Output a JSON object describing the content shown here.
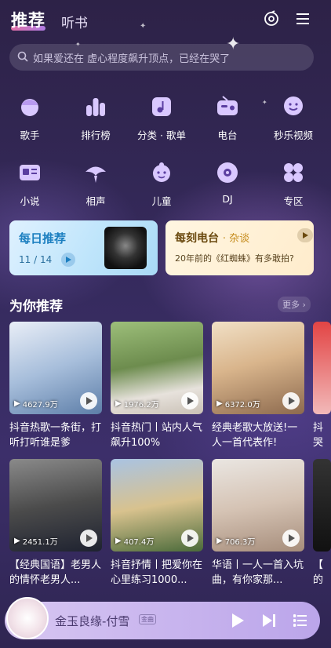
{
  "header": {
    "tabs": [
      {
        "label": "推荐",
        "active": true
      },
      {
        "label": "听书",
        "active": false
      }
    ]
  },
  "search": {
    "placeholder": "如果爱还在 虚心程度飙升顶点，已经在哭了"
  },
  "shortcuts": [
    {
      "label": "歌手",
      "icon": "singer-icon"
    },
    {
      "label": "排行榜",
      "icon": "chart-icon"
    },
    {
      "label": "分类 · 歌单",
      "icon": "playlist-icon"
    },
    {
      "label": "电台",
      "icon": "radio-icon"
    },
    {
      "label": "秒乐视频",
      "icon": "video-icon"
    },
    {
      "label": "小说",
      "icon": "novel-icon"
    },
    {
      "label": "相声",
      "icon": "crosstalk-icon"
    },
    {
      "label": "儿童",
      "icon": "kids-icon"
    },
    {
      "label": "DJ",
      "icon": "dj-icon"
    },
    {
      "label": "专区",
      "icon": "zone-icon"
    }
  ],
  "daily": {
    "title": "每日推荐",
    "date": "11 / 14"
  },
  "radio": {
    "title": "每刻电台",
    "tag": "· 杂谈",
    "desc": "20年前的《红蜘蛛》有多敢拍?"
  },
  "recommend": {
    "title": "为你推荐",
    "more": "更多"
  },
  "playlists": [
    {
      "count": "4627.9万",
      "caption": "抖音热歌一条街，打听打听谁是爹",
      "color": "#c9d6ea"
    },
    {
      "count": "1976.2万",
      "caption": "抖音热门丨站内人气飙升100%",
      "color": "#7fa06a"
    },
    {
      "count": "6372.0万",
      "caption": "经典老歌大放送!一人一首代表作!",
      "color": "#d8b89a"
    },
    {
      "count": "2451.1万",
      "caption": "【经典国语】老男人的情怀老男人...",
      "color": "#6e6a6a"
    },
    {
      "count": "407.4万",
      "caption": "抖音抒情丨把爱你在心里练习1000...",
      "color": "#b5c8dd"
    },
    {
      "count": "706.3万",
      "caption": "华语丨一人一首入坑曲，有你家那...",
      "color": "#d9d2cb"
    }
  ],
  "partial_caps": [
    "抖",
    "哭",
    "【",
    "的"
  ],
  "player": {
    "song": "金玉良缘-付雪",
    "badge": "金曲"
  }
}
